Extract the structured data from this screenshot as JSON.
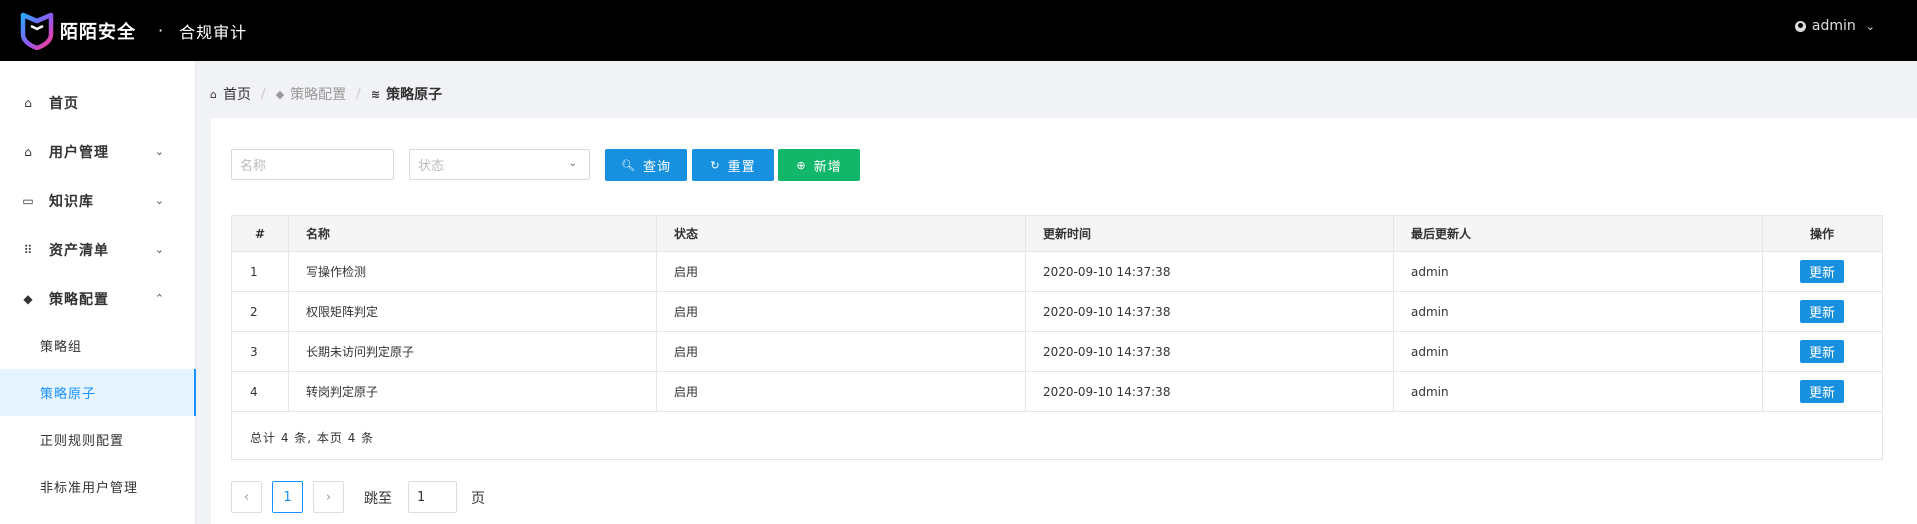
{
  "header": {
    "brand": "陌陌安全",
    "separator": "·",
    "subtitle": "合规审计",
    "user": "admin"
  },
  "sidebar": {
    "items": [
      {
        "label": "首页",
        "icon": "home-icon"
      },
      {
        "label": "用户管理",
        "icon": "home-icon"
      },
      {
        "label": "知识库",
        "icon": "book-icon"
      },
      {
        "label": "资产清单",
        "icon": "grid-icon"
      },
      {
        "label": "策略配置",
        "icon": "cube-icon"
      }
    ],
    "sub_items": [
      {
        "label": "策略组"
      },
      {
        "label": "策略原子"
      },
      {
        "label": "正则规则配置"
      },
      {
        "label": "非标准用户管理"
      }
    ]
  },
  "breadcrumb": {
    "home": "首页",
    "parent": "策略配置",
    "current": "策略原子"
  },
  "filters": {
    "name_placeholder": "名称",
    "status_placeholder": "状态",
    "query_label": "查询",
    "reset_label": "重置",
    "add_label": "新增"
  },
  "table": {
    "columns": [
      "#",
      "名称",
      "状态",
      "更新时间",
      "最后更新人",
      "操作"
    ],
    "rows": [
      {
        "idx": "1",
        "name": "写操作检测",
        "status": "启用",
        "updated": "2020-09-10 14:37:38",
        "user": "admin",
        "action": "更新"
      },
      {
        "idx": "2",
        "name": "权限矩阵判定",
        "status": "启用",
        "updated": "2020-09-10 14:37:38",
        "user": "admin",
        "action": "更新"
      },
      {
        "idx": "3",
        "name": "长期未访问判定原子",
        "status": "启用",
        "updated": "2020-09-10 14:37:38",
        "user": "admin",
        "action": "更新"
      },
      {
        "idx": "4",
        "name": "转岗判定原子",
        "status": "启用",
        "updated": "2020-09-10 14:37:38",
        "user": "admin",
        "action": "更新"
      }
    ],
    "footer": "总计 4 条, 本页 4 条"
  },
  "pagination": {
    "prev": "‹",
    "page": "1",
    "next": "›",
    "goto_label": "跳至",
    "goto_value": "1",
    "page_suffix": "页"
  },
  "colors": {
    "primary": "#1890e0",
    "success": "#12b76a",
    "header_bg": "#000000"
  }
}
